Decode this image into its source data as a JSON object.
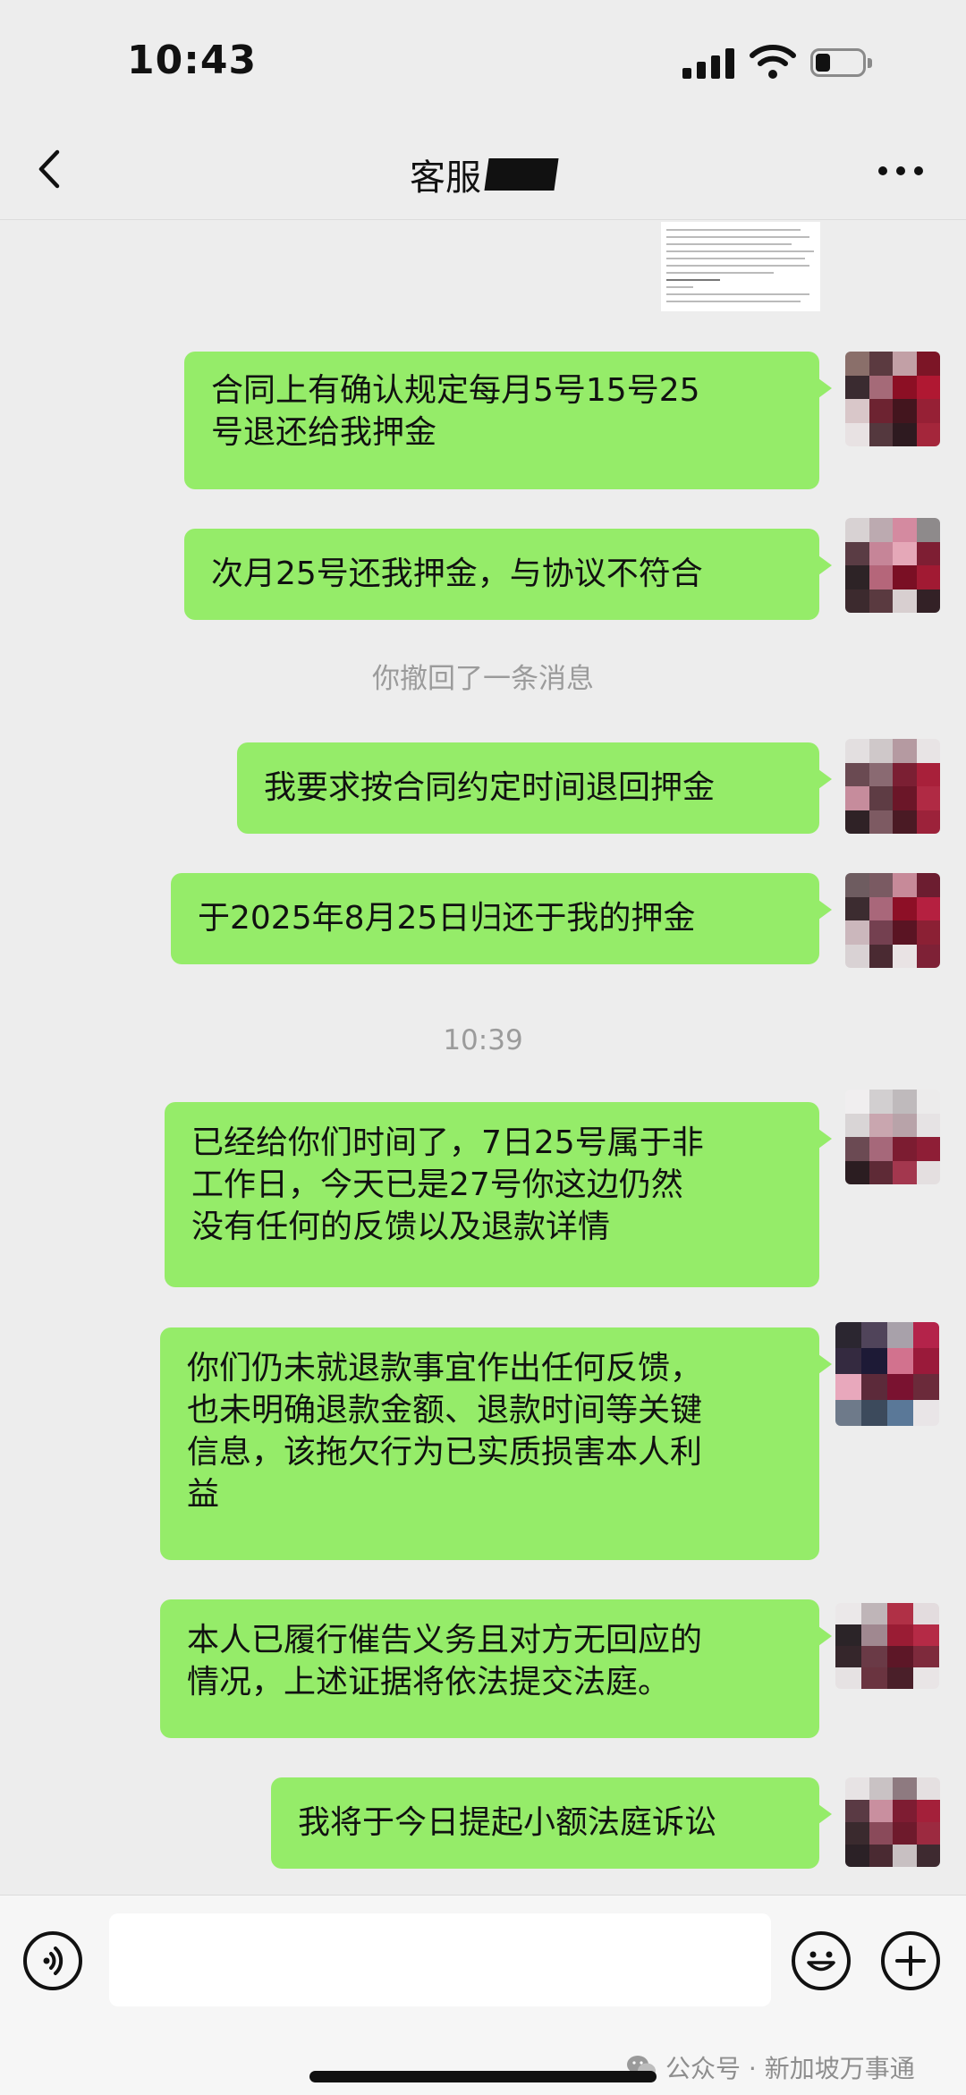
{
  "status_bar": {
    "time": "10:43",
    "battery_level": 0.2
  },
  "header": {
    "title": "客服",
    "back_icon": "chevron-left-icon",
    "more_icon": "more-dots-icon"
  },
  "messages": [
    {
      "text": "合同上有确认规定每月5号15号25\n号退还给我押金"
    },
    {
      "text": "次月25号还我押金，与协议不符合"
    },
    {
      "text": "我要求按合同约定时间退回押金"
    },
    {
      "text": "于2025年8月25日归还于我的押金"
    },
    {
      "text": "已经给你们时间了，7日25号属于非\n工作日，今天已是27号你这边仍然\n没有任何的反馈以及退款详情"
    },
    {
      "text": "你们仍未就退款事宜作出任何反馈，\n也未明确退款金额、退款时间等关键\n信息，该拖欠行为已实质损害本人利\n益"
    },
    {
      "text": "本人已履行催告义务且对方无回应的\n情况，上述证据将依法提交法庭。"
    },
    {
      "text": "我将于今日提起小额法庭诉讼"
    }
  ],
  "system": {
    "recalled": "你撤回了一条消息",
    "timestamp": "10:39"
  },
  "input_bar": {
    "voice_icon": "voice-icon",
    "emoji_icon": "emoji-icon",
    "plus_icon": "plus-icon"
  },
  "watermark": {
    "text": "公众号 · 新加坡万事通"
  },
  "colors": {
    "bubble": "#95ec69",
    "background": "#ededed"
  }
}
